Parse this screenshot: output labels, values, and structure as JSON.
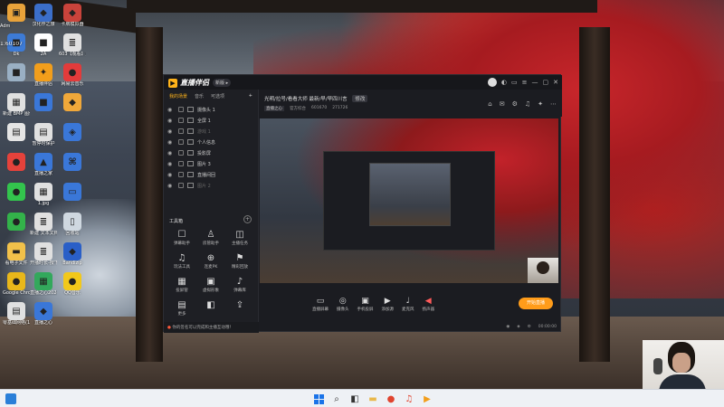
{
  "desktop": {
    "top_label_1": "Adm",
    "top_label_2": "1:60107",
    "icons": [
      {
        "label": "",
        "color": "#e8a23a",
        "glyph": "▣"
      },
      {
        "label": "汉化作之旅",
        "color": "#3b6ec9",
        "glyph": "◆"
      },
      {
        "label": "卡牌模拟器",
        "color": "#c9433b",
        "glyph": "◆"
      },
      {
        "label": "Dk",
        "color": "#3d7bd6",
        "glyph": "■"
      },
      {
        "label": "2A",
        "color": "#ffffff",
        "glyph": "■"
      },
      {
        "label": "603【观看】直播之...",
        "color": "#e0e0e0",
        "glyph": "≣"
      },
      {
        "label": "",
        "color": "#9ab0c4",
        "glyph": "■"
      },
      {
        "label": "直播伴侣",
        "color": "#f29e1b",
        "glyph": "✦"
      },
      {
        "label": "网易云音乐",
        "color": "#e23b3b",
        "glyph": "●"
      },
      {
        "label": "新建 BMP 图像.bmp",
        "color": "#e0e0e0",
        "glyph": "▦"
      },
      {
        "label": "",
        "color": "#3a77d8",
        "glyph": "■"
      },
      {
        "label": "",
        "color": "#f0a83a",
        "glyph": "◆"
      },
      {
        "label": "",
        "color": "#e5e5e5",
        "glyph": "▤"
      },
      {
        "label": "暂停时保护",
        "color": "#e0e0e0",
        "glyph": "▤"
      },
      {
        "label": "",
        "color": "#3a77d8",
        "glyph": "◈"
      },
      {
        "label": "",
        "color": "#e5423b",
        "glyph": "●"
      },
      {
        "label": "直播之家",
        "color": "#3a77d8",
        "glyph": "▲"
      },
      {
        "label": "",
        "color": "#3a77d8",
        "glyph": "⌘"
      },
      {
        "label": "",
        "color": "#33c44d",
        "glyph": "●"
      },
      {
        "label": "1.jpg",
        "color": "#e0e0e0",
        "glyph": "▦"
      },
      {
        "label": "",
        "color": "#3a77d8",
        "glyph": "▭"
      },
      {
        "label": "",
        "color": "#33b24a",
        "glyph": "●"
      },
      {
        "label": "新建 文本文档.txt",
        "color": "#e0e0e0",
        "glyph": "≣"
      },
      {
        "label": "回收站",
        "color": "#cfd8e0",
        "glyph": "▯"
      },
      {
        "label": "看电子文件",
        "color": "#f2c14a",
        "glyph": "▬"
      },
      {
        "label": "开播时长-按下-请按播",
        "color": "#e0e0e0",
        "glyph": "≣"
      },
      {
        "label": "Bandizip",
        "color": "#2a5fc7",
        "glyph": "◆"
      },
      {
        "label": "Google Chrome",
        "color": "#e8b71a",
        "glyph": "●"
      },
      {
        "label": "直播之心2024价格表.xls",
        "color": "#33a85c",
        "glyph": "▦"
      },
      {
        "label": "QQ音乐",
        "color": "#f2c81a",
        "glyph": "●"
      },
      {
        "label": "零基础网络(1).docx",
        "color": "#e0e0e0",
        "glyph": "▤"
      },
      {
        "label": "直播之心",
        "color": "#3a77d8",
        "glyph": "◆"
      }
    ]
  },
  "app": {
    "title": "直播伴侣",
    "version_badge": "新版 ▸",
    "window_controls": [
      "◐",
      "▭",
      "≡",
      "—",
      "▢",
      "✕"
    ],
    "panel_tabs": [
      "我的场景",
      "音乐",
      "可选项"
    ],
    "panel_add": "+",
    "scenes": [
      {
        "name": "摄像头 1",
        "dim": false
      },
      {
        "name": "全屏 1",
        "dim": false
      },
      {
        "name": "游戏 1",
        "dim": true
      },
      {
        "name": "个人信息",
        "dim": false
      },
      {
        "name": "投影屏",
        "dim": false
      },
      {
        "name": "图片 3",
        "dim": false
      },
      {
        "name": "直播间回",
        "dim": false
      },
      {
        "name": "图片 2",
        "dim": true
      }
    ],
    "tools_title": "工具箱",
    "tools_add": "+",
    "tools": [
      {
        "icon": "☐",
        "label": "弹幕助手"
      },
      {
        "icon": "♙",
        "label": "房管助手"
      },
      {
        "icon": "◫",
        "label": "主播任务"
      },
      {
        "icon": "♫",
        "label": "玩法工具"
      },
      {
        "icon": "⊕",
        "label": "连麦PK"
      },
      {
        "icon": "⚑",
        "label": "精彩回放"
      },
      {
        "icon": "▦",
        "label": "投屏管"
      },
      {
        "icon": "▣",
        "label": "虚拟形象"
      },
      {
        "icon": "♪",
        "label": "弹幕库"
      },
      {
        "icon": "▤",
        "label": "更多"
      },
      {
        "icon": "◧",
        "label": ""
      },
      {
        "icon": "⇪",
        "label": ""
      }
    ],
    "tip_icon": "●",
    "tip_text": "你的签名可以完成和主播互动哦！",
    "room_title": "光明/拉号/看看大师 最新/早/早四川言",
    "room_edit": "修改",
    "room_meta": {
      "tag": "直播之心",
      "category": "官方综合",
      "room_id": "601670",
      "fans": "271726"
    },
    "room_icons": [
      "⌂",
      "✉",
      "⚙",
      "♫",
      "✦",
      "⋯"
    ],
    "bottom_buttons": [
      {
        "icon": "▭",
        "label": "直播屏幕",
        "accent": false
      },
      {
        "icon": "◎",
        "label": "摄像头",
        "accent": false
      },
      {
        "icon": "▣",
        "label": "手机投屏",
        "accent": false
      },
      {
        "icon": "▶",
        "label": "添加源",
        "accent": false
      },
      {
        "icon": "♩",
        "label": "麦克风",
        "accent": false
      },
      {
        "icon": "◀",
        "label": "扬声器",
        "accent": true
      }
    ],
    "start_button": "开始直播",
    "status": {
      "left": "◉",
      "mid": "◈",
      "right": "⚙",
      "timer": "00:00:00"
    }
  },
  "taskbar": {
    "items": [
      "search-icon",
      "taskview-icon",
      "explorer-icon",
      "chrome-icon",
      "music-icon",
      "app-icon"
    ]
  }
}
